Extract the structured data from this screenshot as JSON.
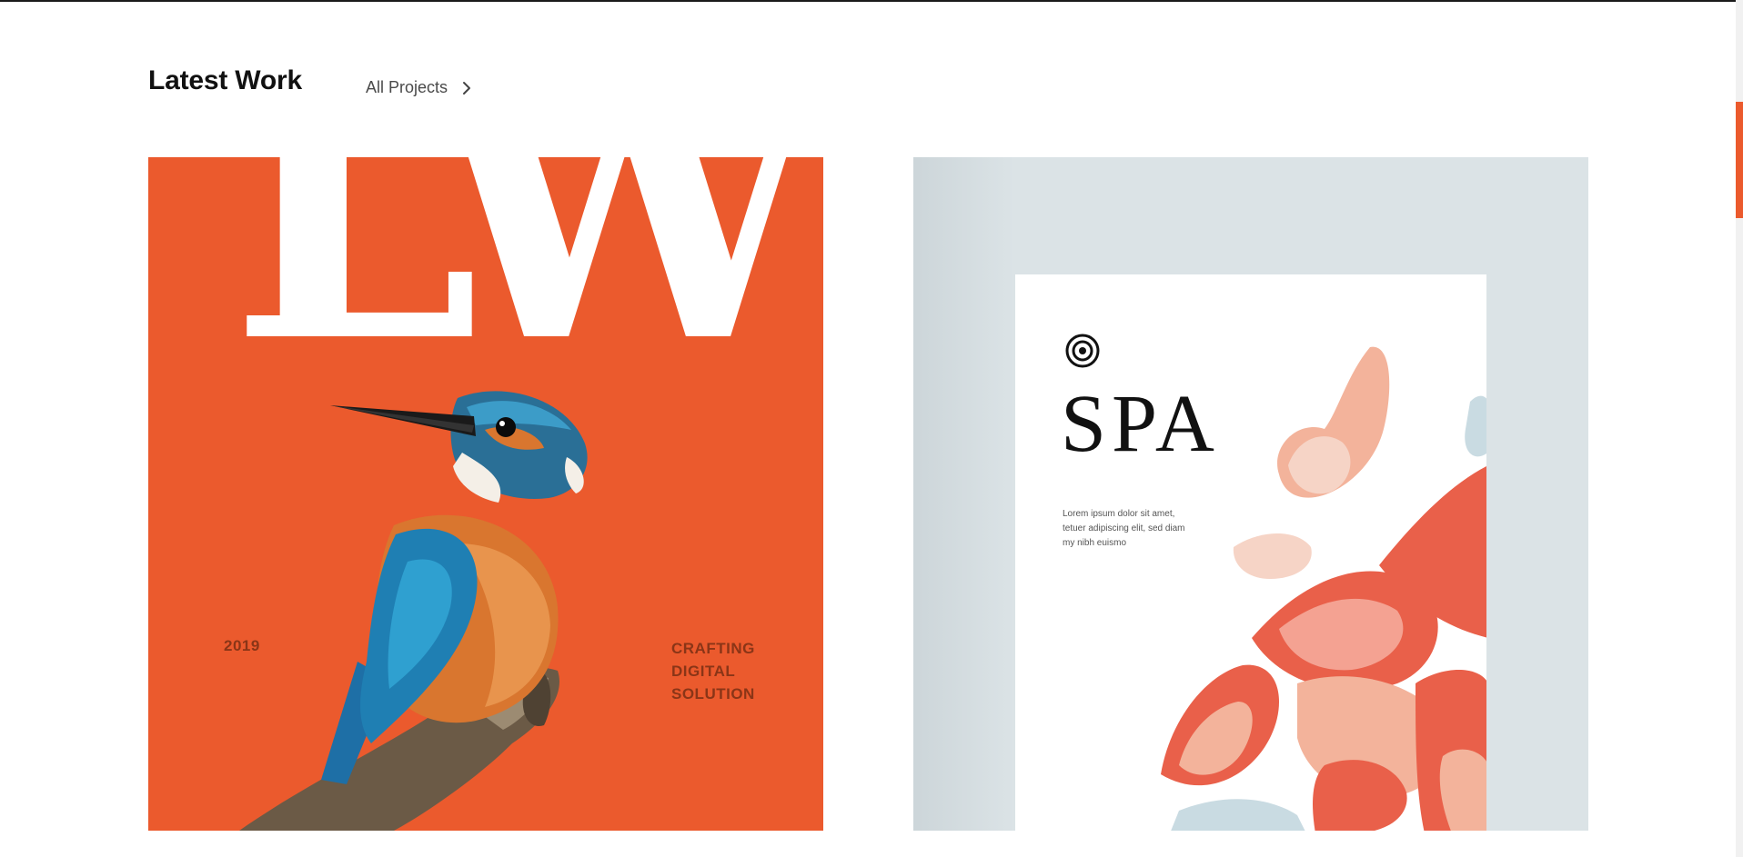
{
  "header": {
    "title": "Latest Work",
    "all_projects_label": "All Projects",
    "link_icon": "chevron-right-icon"
  },
  "projects": [
    {
      "big_letters": "LW",
      "year": "2019",
      "tagline": [
        "CRAFTING",
        "DIGITAL",
        "SOLUTION"
      ],
      "background": "#eb5a2d"
    },
    {
      "brand_icon": "concentric-circle-logo-icon",
      "title": "SPA",
      "body_lines": [
        "Lorem ipsum dolor sit amet,",
        "tetuer adipiscing elit, sed diam",
        "my nibh euismo"
      ],
      "background": "#dbe3e6"
    }
  ],
  "colors": {
    "accent": "#eb5a2d",
    "text_dark": "#111111",
    "scroll_thumb": "#eb5a2d"
  }
}
